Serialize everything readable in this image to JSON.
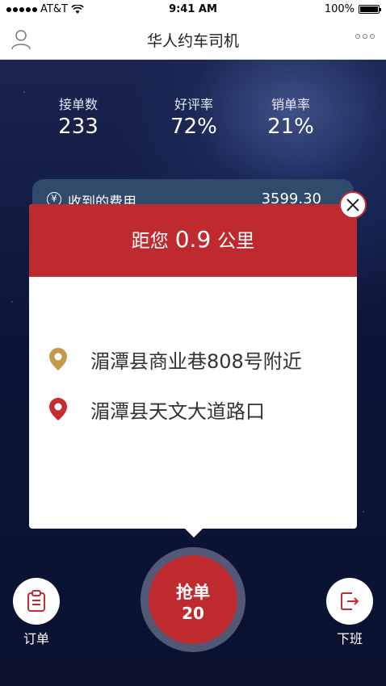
{
  "status_bar": {
    "carrier": "AT&T",
    "time": "9:41 AM",
    "battery": "100%"
  },
  "nav": {
    "title": "华人约车司机"
  },
  "stats": {
    "orders_label": "接单数",
    "orders_value": "233",
    "rating_label": "好评率",
    "rating_value": "72%",
    "cancel_label": "销单率",
    "cancel_value": "21%"
  },
  "fee_card": {
    "label": "收到的费用",
    "value": "3599.30"
  },
  "popup": {
    "distance_prefix": "距您",
    "distance_value": "0.9",
    "distance_unit": "公里",
    "start_address": "湄潭县商业巷808号附近",
    "end_address": "湄潭县天文大道路口"
  },
  "actions": {
    "grab_label": "抢单",
    "grab_count": "20",
    "orders_label": "订单",
    "offduty_label": "下班"
  },
  "colors": {
    "accent_red": "#bf2a2e",
    "start_pin": "#c39a4c",
    "end_pin": "#c52b2f"
  },
  "icons": {
    "nav_left": "user-icon",
    "nav_right": "more-icon",
    "close": "close-icon",
    "start": "location-pin-icon",
    "end": "destination-pin-icon",
    "orders": "clipboard-icon",
    "offduty": "logout-icon",
    "fee": "yen-icon"
  }
}
